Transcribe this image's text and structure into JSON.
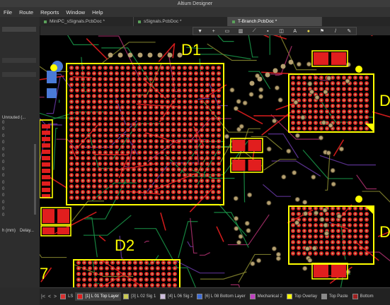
{
  "window": {
    "title": "Altium Designer"
  },
  "menu": [
    "File",
    "Route",
    "Reports",
    "Window",
    "Help"
  ],
  "tabs": [
    {
      "label": "MiniPC_sSignals.PcbDoc *",
      "active": false
    },
    {
      "label": "sSignals.PcbDoc *",
      "active": false
    },
    {
      "label": "T-Branch.PcbDoc *",
      "active": true
    }
  ],
  "left_panel": {
    "list_header": "Unrouted (...",
    "list_items": [
      "0",
      "0",
      "0",
      "0",
      "0",
      "0",
      "0",
      "0",
      "0",
      "0",
      "0",
      "0",
      "0",
      "0",
      "0"
    ],
    "footer": [
      "h (mm)",
      "Delay..."
    ]
  },
  "toolbar_icons": [
    "filter-icon",
    "plus-icon",
    "rect-icon",
    "chart-icon",
    "route-icon",
    "rect2-icon",
    "pad-icon",
    "text-icon",
    "bulb-icon",
    "flag-icon",
    "line-icon",
    "tool-icon"
  ],
  "designators": {
    "D1": "D1",
    "D2": "D2",
    "D3": "D",
    "D4": "D",
    "L7": "7"
  },
  "statusbar": {
    "nav": [
      "|<",
      "<",
      ">"
    ],
    "layers": [
      {
        "label": "LS",
        "color": "#d83030",
        "active": false
      },
      {
        "label": "[1] L 01 Top Layer",
        "color": "#e11e1e",
        "active": true
      },
      {
        "label": "[3] L 02 Sig 1",
        "color": "#c8c850",
        "active": false
      },
      {
        "label": "[4] L 06 Sig 2",
        "color": "#cdbcdc",
        "active": false
      },
      {
        "label": "[6] L 08 Bottom Layer",
        "color": "#3c6cd8",
        "active": false
      },
      {
        "label": "Mechanical 2",
        "color": "#c040c0",
        "active": false
      },
      {
        "label": "Top Overlay",
        "color": "#ffff00",
        "active": false
      },
      {
        "label": "Top Paste",
        "color": "#8a8a8a",
        "active": false
      },
      {
        "label": "Bottom",
        "color": "#a02020",
        "active": false
      }
    ]
  },
  "colors": {
    "silkscreen": "#ffff00",
    "top_copper": "#e11e1e",
    "trace_green": "#1a9a4a",
    "via": "#b5a070",
    "board": "#000000"
  }
}
